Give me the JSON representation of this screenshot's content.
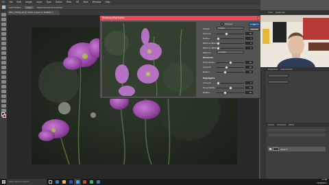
{
  "menubar": {
    "items": [
      "Ps",
      "File",
      "Edit",
      "Image",
      "Layer",
      "Type",
      "Select",
      "Filter",
      "3D",
      "View",
      "Window",
      "Help"
    ]
  },
  "optionsbar": {
    "items": [
      "Auto-Select:",
      "Layer",
      "Show Transform Controls"
    ]
  },
  "document": {
    "tab_label": "IMG_1753CJ.tif @ 100% (Layer 0, RGB/8*) *"
  },
  "dialog": {
    "title": "Shadows/Highlights",
    "shadows_label": "Shadows",
    "highlights_label": "Highlights",
    "buttons": {
      "ok": "OK",
      "cancel": "Cancel"
    },
    "rows": [
      {
        "label": "Preset:",
        "value": "Custom",
        "kind": "dropdown"
      },
      {
        "label": "Amount:",
        "value": "35"
      },
      {
        "label": "Radius:",
        "value": "1"
      },
      {
        "label": "Midtone Black:",
        "value": "0"
      },
      {
        "label": "Midtone White:",
        "value": "0"
      },
      {
        "label": "Method:",
        "value": "Local Blur",
        "kind": "dropdown"
      }
    ],
    "shadow_rows": [
      {
        "label": "Tonal Width:",
        "value": "50"
      },
      {
        "label": "Amount:",
        "value": "35"
      },
      {
        "label": "Radius:",
        "value": "30"
      }
    ],
    "highlight_rows": [
      {
        "label": "Amount:",
        "value": "0"
      },
      {
        "label": "Tonal Width:",
        "value": "50"
      },
      {
        "label": "Radius:",
        "value": "30"
      }
    ],
    "toggle_label": "Preview"
  },
  "panels": {
    "top_tabs": [
      "Color",
      "Swatches"
    ],
    "mid_tabs": [
      "Properties",
      "Adjustments"
    ],
    "layers_tabs": [
      "Layers",
      "Channels",
      "Paths"
    ],
    "layer_name": "Layer 0"
  },
  "taskbar": {
    "search_placeholder": "Type here to search",
    "time": "11:08",
    "date": "25/08/2017",
    "icon_colors": [
      "#2f7cd3",
      "#f1b53b",
      "#0f62c4",
      "#31a8ff",
      "#e23a3a",
      "#2ebd59",
      "#31a8ff"
    ]
  },
  "colors": {
    "accent": "#e94b58",
    "ps_bg": "#535353",
    "fg_swatch": "#111111",
    "bg_swatch": "#c8102e"
  }
}
